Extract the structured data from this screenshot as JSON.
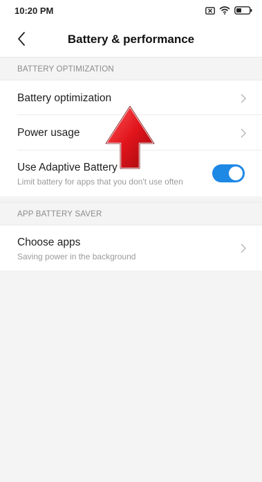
{
  "status_bar": {
    "time": "10:20 PM",
    "icons": [
      "sim-x-icon",
      "wifi-icon",
      "battery-icon"
    ]
  },
  "header": {
    "title": "Battery & performance",
    "back_icon": "chevron-left-icon"
  },
  "sections": [
    {
      "title": "BATTERY OPTIMIZATION",
      "items": [
        {
          "label": "Battery optimization",
          "type": "link"
        },
        {
          "label": "Power usage",
          "type": "link"
        },
        {
          "label": "Use Adaptive Battery",
          "subtitle": "Limit battery for apps that you don't use often",
          "type": "toggle",
          "checked": true
        }
      ]
    },
    {
      "title": "APP BATTERY SAVER",
      "items": [
        {
          "label": "Choose apps",
          "subtitle": "Saving power in the background",
          "type": "link"
        }
      ]
    }
  ],
  "overlay": {
    "annotation_icon": "red-up-arrow-icon"
  },
  "colors": {
    "toggle_on": "#1e88e5",
    "arrow_red": "#e0141b",
    "background": "#f4f4f4"
  }
}
